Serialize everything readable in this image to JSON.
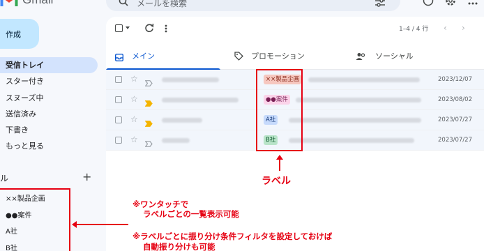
{
  "app": {
    "name": "Gmail"
  },
  "search": {
    "placeholder": "メールを検索"
  },
  "sidebar": {
    "compose_label": "作成",
    "nav_items": [
      {
        "label": "受信トレイ",
        "active": true
      },
      {
        "label": "スター付き",
        "active": false
      },
      {
        "label": "スヌーズ中",
        "active": false
      },
      {
        "label": "送信済み",
        "active": false
      },
      {
        "label": "下書き",
        "active": false
      },
      {
        "label": "もっと見る",
        "active": false
      }
    ],
    "labels_title": "ル",
    "labels_add": "+",
    "labels": [
      "××製品企画",
      "●●案件",
      "A社",
      "B社"
    ]
  },
  "toolbar": {
    "pager": "1–4 / 4 行",
    "prev": "‹",
    "next": "›"
  },
  "tabs": [
    {
      "label": "メイン",
      "icon": "inbox-icon",
      "active": true
    },
    {
      "label": "プロモーション",
      "icon": "tag-icon",
      "active": false
    },
    {
      "label": "ソーシャル",
      "icon": "people-icon",
      "active": false
    }
  ],
  "emails": [
    {
      "label": "××製品企画",
      "date": "2023/12/07",
      "chip_bg": "#f6c7bf",
      "chip_fg": "#8a2b1d",
      "important": false
    },
    {
      "label": "●●案件",
      "date": "2023/08/02",
      "chip_bg": "#fbd3e9",
      "chip_fg": "#7a1f55",
      "important": true
    },
    {
      "label": "A社",
      "date": "2023/07/27",
      "chip_bg": "#c6dafc",
      "chip_fg": "#1a3d7c",
      "important": true
    },
    {
      "label": "B社",
      "date": "2023/07/27",
      "chip_bg": "#b9e4c9",
      "chip_fg": "#0d5b2e",
      "important": false
    }
  ],
  "annotations": {
    "label_caption": "ラベル",
    "note_1_line_1": "※ワンタッチで",
    "note_1_line_2": "ラベルごとの一覧表示可能",
    "note_2_line_1": "※ラベルごとに振り分け条件フィルタを設定しておけば",
    "note_2_line_2": "自動振り分けも可能"
  },
  "colors": {
    "accent": "#0b57d0",
    "annotation": "#e60012",
    "compose": "#c2e7ff"
  }
}
